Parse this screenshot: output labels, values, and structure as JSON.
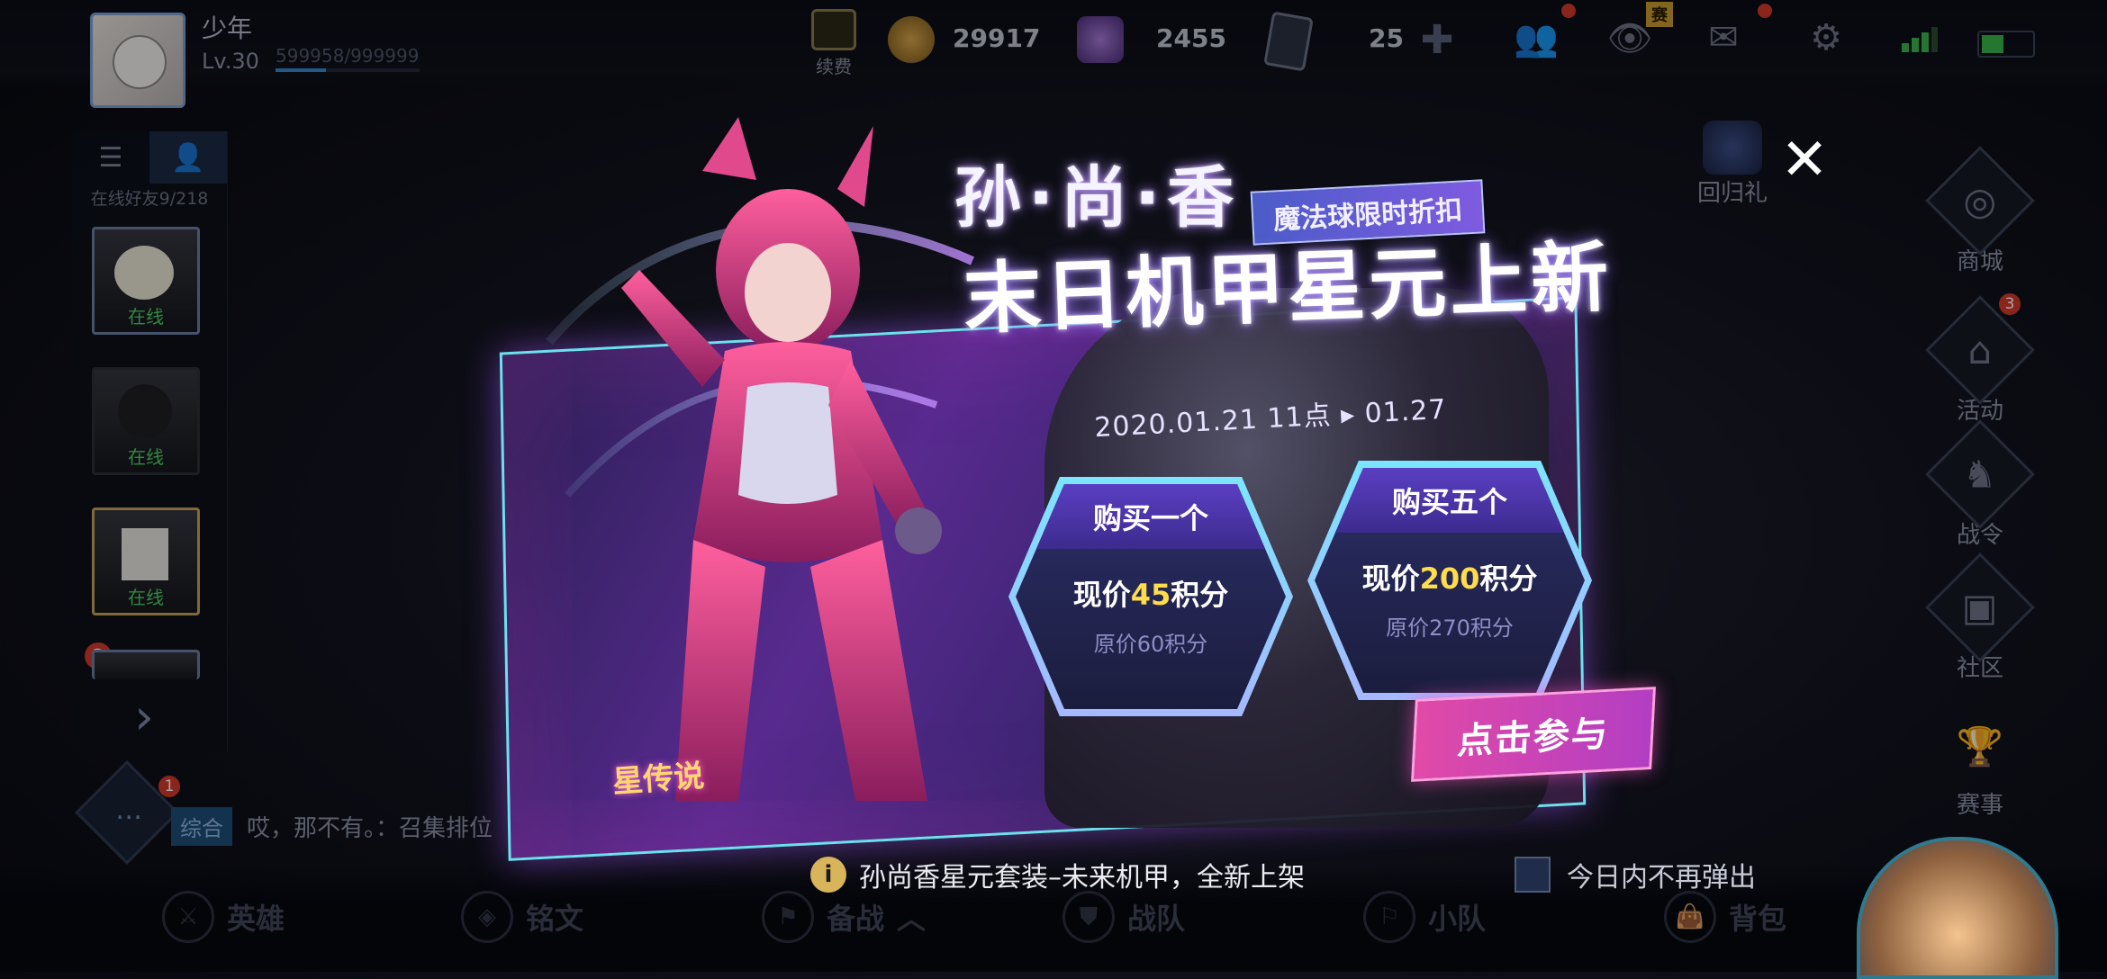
{
  "player": {
    "name": "少年",
    "level": "Lv.30",
    "exp": "599958/999999",
    "exp_fraction": 0.35
  },
  "currencies": {
    "renew_label": "续费",
    "gold": "29917",
    "diamonds": "2455",
    "coupons": "25"
  },
  "top_icons": {
    "events_badge": "赛"
  },
  "friends": {
    "online_count": "在线好友9/218",
    "cards": [
      {
        "status": "在线"
      },
      {
        "status": "在线"
      },
      {
        "status": "在线"
      }
    ],
    "notif_badge": "3"
  },
  "side_menu": {
    "return_gift": "回归礼",
    "items": [
      {
        "label": "商城",
        "icon": "shop-icon"
      },
      {
        "label": "活动",
        "icon": "activity-icon",
        "badge": "3"
      },
      {
        "label": "战令",
        "icon": "battle-pass-icon"
      },
      {
        "label": "社区",
        "icon": "community-icon"
      },
      {
        "label": "赛事",
        "icon": "tournament-icon"
      }
    ]
  },
  "chat": {
    "badge": "1",
    "channel": "综合",
    "message": "哎，那不有。：召集排位"
  },
  "bottom_nav": [
    {
      "label": "英雄",
      "icon": "hero-icon"
    },
    {
      "label": "铭文",
      "icon": "rune-icon"
    },
    {
      "label": "备战",
      "icon": "prepare-icon"
    },
    {
      "label": "战队",
      "icon": "team-icon"
    },
    {
      "label": "小队",
      "icon": "squad-icon"
    },
    {
      "label": "背包",
      "icon": "bag-icon"
    }
  ],
  "popup": {
    "hero_name": "孙·尚·香",
    "headline": "末日机甲星元上新",
    "promo_tag": "魔法球限时折扣",
    "date_range": "2020.01.21 11点 ▸ 01.27",
    "offers": [
      {
        "title": "购买一个",
        "now_prefix": "现价",
        "now_value": "45",
        "now_suffix": "积分",
        "original": "原价60积分"
      },
      {
        "title": "购买五个",
        "now_prefix": "现价",
        "now_value": "200",
        "now_suffix": "积分",
        "original": "原价270积分"
      }
    ],
    "join_button": "点击参与",
    "series_logo": "星传说",
    "close_glyph": "✕",
    "caption": "孙尚香星元套装–未来机甲，全新上架",
    "dont_show_today": "今日内不再弹出"
  },
  "colors": {
    "accent_cyan": "#6de0ee",
    "accent_pink": "#e14aa7",
    "price_yellow": "#ffdd4a"
  }
}
